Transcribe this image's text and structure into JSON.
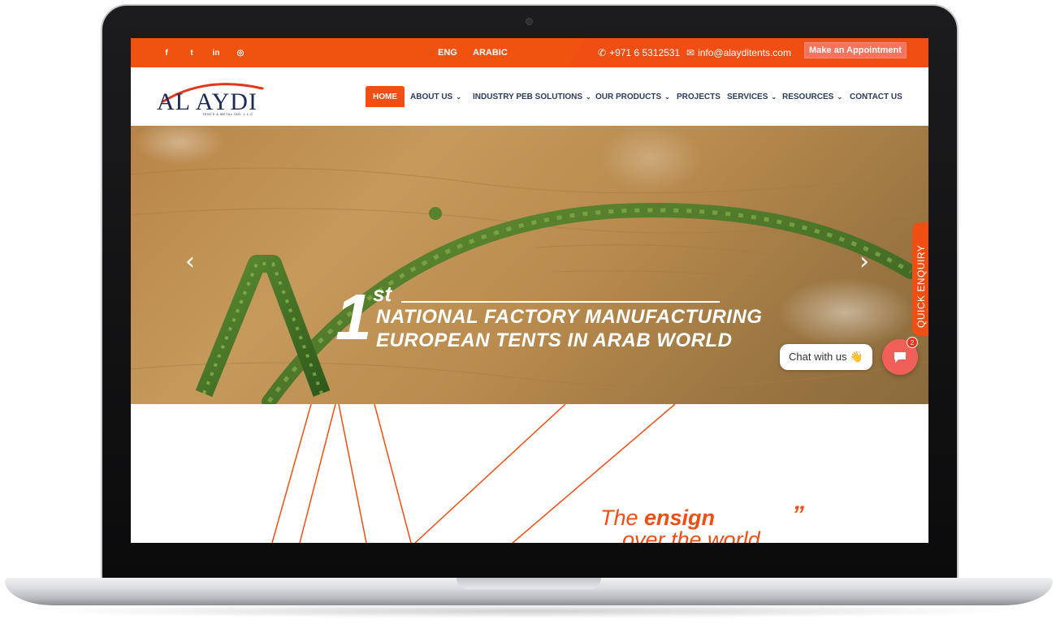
{
  "colors": {
    "accent": "#f04e12",
    "nav_text": "#2a3b5e",
    "chat_button": "#f06058"
  },
  "topbar": {
    "social": [
      {
        "icon": "facebook-icon",
        "glyph": "f"
      },
      {
        "icon": "twitter-icon",
        "glyph": "t"
      },
      {
        "icon": "linkedin-icon",
        "glyph": "in"
      },
      {
        "icon": "instagram-icon",
        "glyph": "◎"
      }
    ],
    "lang_eng": "ENG",
    "lang_arabic": "ARABIC",
    "phone": "+971 6 5312531",
    "email": "info@alayditents.com",
    "appointment": "Make an Appointment"
  },
  "header": {
    "logo_text": "AL AYDI",
    "logo_sub": "TENTS & METAL IND. L.L.C",
    "nav": {
      "home": "HOME",
      "about": "ABOUT US",
      "industry": "INDUSTRY PEB SOLUTIONS",
      "products": "OUR PRODUCTS",
      "projects": "PROJECTS",
      "services": "SERVICES",
      "resources": "RESOURCES",
      "contact": "CONTACT US"
    }
  },
  "hero": {
    "one": "1",
    "st": "st",
    "line1": "NATIONAL FACTORY MANUFACTURING",
    "line2": "EUROPEAN TENTS IN ARAB WORLD",
    "prev": "‹",
    "next": "›"
  },
  "quick_enquiry": "QUICK ENQUIRY",
  "chat": {
    "label": "Chat with us 👋",
    "badge": "2"
  },
  "tagline": {
    "the": "The ",
    "ensign": "ensign",
    "line2": "over the world",
    "quote": "”"
  }
}
